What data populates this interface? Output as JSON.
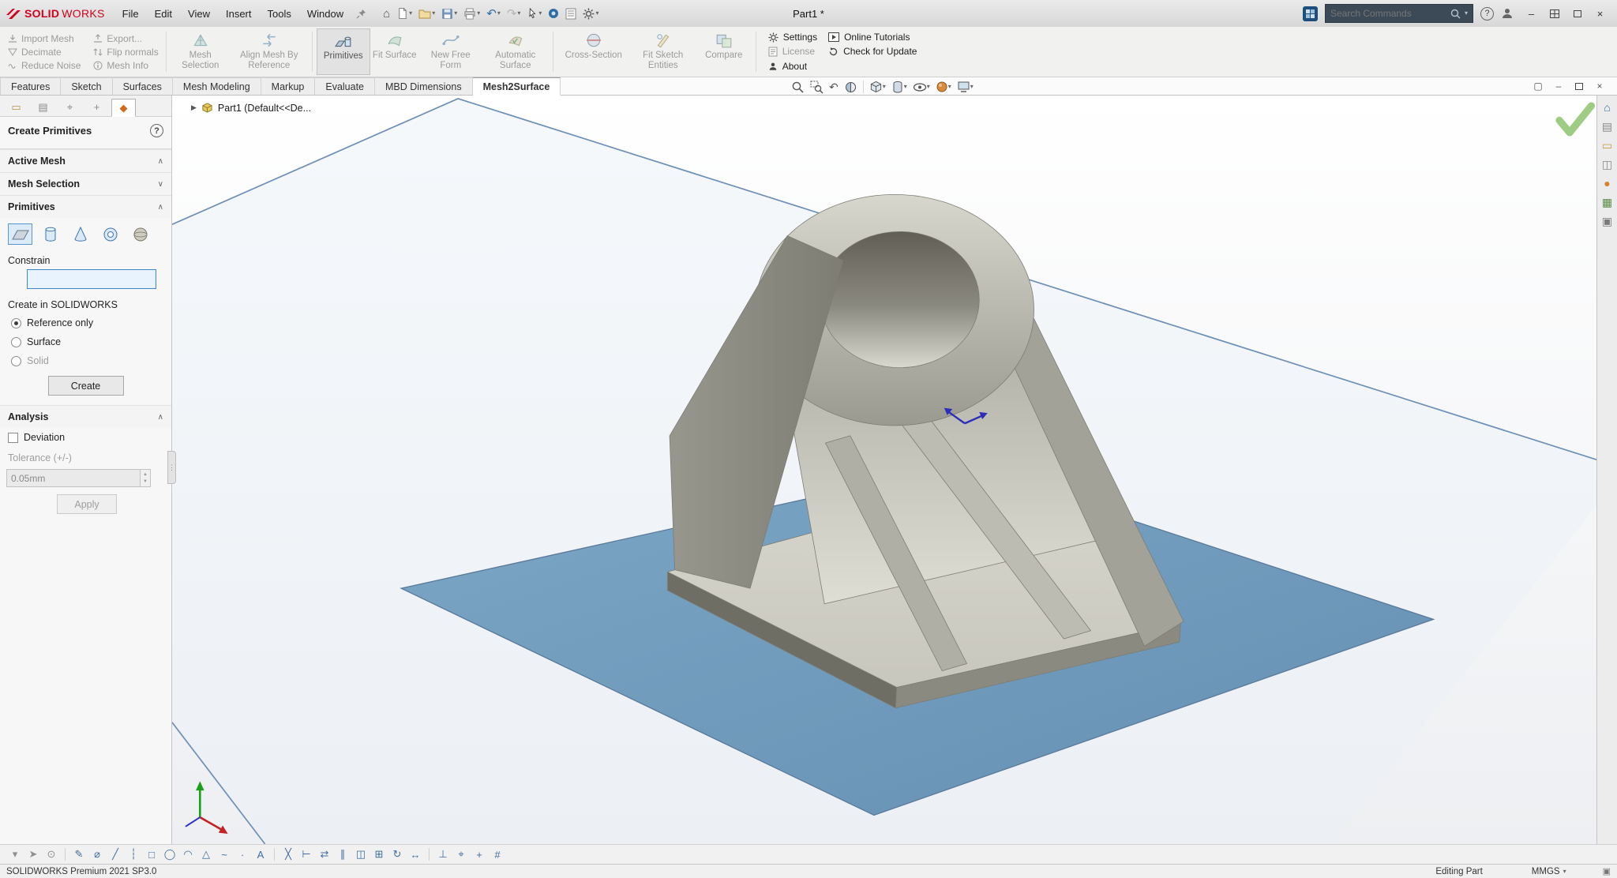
{
  "titlebar": {
    "logo_bold": "SOLID",
    "logo_light": "WORKS",
    "menus": [
      "File",
      "Edit",
      "View",
      "Insert",
      "Tools",
      "Window"
    ],
    "document_title": "Part1 *",
    "search": {
      "placeholder": "Search Commands"
    }
  },
  "ribbon": {
    "small": [
      [
        "Import Mesh",
        "Export..."
      ],
      [
        "Decimate",
        "Flip normals"
      ],
      [
        "Reduce Noise",
        "Mesh Info"
      ]
    ],
    "large": [
      "Mesh Selection",
      "Align Mesh By Reference",
      "Primitives",
      "Fit Surface",
      "New Free Form",
      "Automatic Surface",
      "Cross-Section",
      "Fit Sketch Entities",
      "Compare"
    ],
    "links": [
      "Settings",
      "Online Tutorials",
      "License",
      "Check for Update",
      "About"
    ],
    "active_tool": "Primitives"
  },
  "tabs": {
    "items": [
      "Features",
      "Sketch",
      "Surfaces",
      "Mesh Modeling",
      "Markup",
      "Evaluate",
      "MBD Dimensions",
      "Mesh2Surface"
    ],
    "active": "Mesh2Surface"
  },
  "panel": {
    "title": "Create Primitives",
    "tab_glyphs": [
      "▭",
      "▤",
      "⌖",
      "+",
      "◆"
    ],
    "sections": {
      "active_mesh": "Active Mesh",
      "mesh_selection": "Mesh Selection",
      "primitives": "Primitives",
      "analysis": "Analysis"
    },
    "primitive_tools": [
      "plane",
      "cylinder",
      "cone",
      "torus",
      "sphere"
    ],
    "selected_primitive": "plane",
    "constrain_label": "Constrain",
    "constrain_value": "",
    "create_in_label": "Create in SOLIDWORKS",
    "radios": [
      "Reference only",
      "Surface",
      "Solid"
    ],
    "selected_radio": "Reference only",
    "create_button": "Create",
    "deviation_label": "Deviation",
    "deviation_checked": false,
    "tolerance_label": "Tolerance (+/-)",
    "tolerance_value": "0.05mm",
    "apply_button": "Apply"
  },
  "viewport": {
    "tree_root": "Part1 (Default<<De..."
  },
  "taskpane": {
    "glyphs": [
      "⌂",
      "▤",
      "▭",
      "◫",
      "●",
      "▦",
      "▣"
    ]
  },
  "bottom": {
    "icons": [
      {
        "n": "selection-filter",
        "g": "▾"
      },
      {
        "n": "select",
        "g": "➤"
      },
      {
        "n": "magnified-selection",
        "g": "⊙"
      },
      {
        "n": "sketch",
        "g": "✎"
      },
      {
        "n": "smart-dimension",
        "g": "⌀"
      },
      {
        "n": "line",
        "g": "╱"
      },
      {
        "n": "centerline",
        "g": "┆"
      },
      {
        "n": "corner-rectangle",
        "g": "□"
      },
      {
        "n": "circle",
        "g": "◯"
      },
      {
        "n": "arc",
        "g": "◠"
      },
      {
        "n": "polygon",
        "g": "△"
      },
      {
        "n": "spline",
        "g": "~"
      },
      {
        "n": "point",
        "g": "∙"
      },
      {
        "n": "text",
        "g": "A"
      },
      {
        "n": "trim-entities",
        "g": "╳"
      },
      {
        "n": "extend-entities",
        "g": "⊢"
      },
      {
        "n": "convert-entities",
        "g": "⇄"
      },
      {
        "n": "offset-entities",
        "g": "∥"
      },
      {
        "n": "mirror-entities",
        "g": "◫"
      },
      {
        "n": "linear-pattern",
        "g": "⊞"
      },
      {
        "n": "circular-pattern",
        "g": "↻"
      },
      {
        "n": "move-entities",
        "g": "↔"
      },
      {
        "n": "add-relation",
        "g": "⊥"
      },
      {
        "n": "display-relations",
        "g": "⌖"
      },
      {
        "n": "repair-sketch",
        "g": "+"
      },
      {
        "n": "quick-snaps",
        "g": "#"
      }
    ]
  },
  "statusbar": {
    "product": "SOLIDWORKS Premium 2021 SP3.0",
    "mode": "Editing Part",
    "units": "MMGS"
  },
  "icons": {
    "caret": "▾",
    "home": "⌂",
    "undo": "↶",
    "redo": "↷",
    "help": "?",
    "minimize": "–",
    "close": "×",
    "chevron_up": "∧",
    "chevron_down": "∨",
    "tree_arrow": "▶",
    "up": "▲",
    "down": "▼",
    "panel_toggle": "▣",
    "new_window": "▢"
  },
  "colors": {
    "plane_blue": "#6f9cbd",
    "model_gray": "#b4b3a9",
    "check_green": "#8cc36c",
    "logo_red": "#d0021b",
    "accent_blue": "#3e86cf"
  }
}
